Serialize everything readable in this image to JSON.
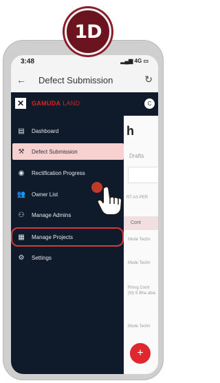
{
  "badge": {
    "text": "1D"
  },
  "status_bar": {
    "time": "3:48",
    "network": "4G"
  },
  "header": {
    "title": "Defect Submission"
  },
  "drawer": {
    "brand_strong": "GAMUDA",
    "brand_light": "LAND",
    "avatar": "C",
    "items": [
      {
        "label": "Dashboard",
        "icon": "dashboard-icon",
        "glyph": "▤"
      },
      {
        "label": "Defect Submission",
        "icon": "hammer-icon",
        "glyph": "⚒"
      },
      {
        "label": "Rectification Progress",
        "icon": "progress-icon",
        "glyph": "◉"
      },
      {
        "label": "Owner List",
        "icon": "people-icon",
        "glyph": "👥"
      },
      {
        "label": "Manage Admins",
        "icon": "admin-icon",
        "glyph": "⚇"
      },
      {
        "label": "Manage Projects",
        "icon": "building-icon",
        "glyph": "▦"
      },
      {
        "label": "Settings",
        "icon": "gear-icon",
        "glyph": "⚙"
      }
    ]
  },
  "background": {
    "heading": "h",
    "drafts": "Drafts",
    "sort_label": "RT AS PER",
    "column_header": "Cont",
    "cells": [
      "Mode Techn",
      "Mode Techn",
      "Rmsg Contr (M) S Bha abia",
      "Mode Techn"
    ]
  },
  "fab": {
    "label": "+"
  }
}
